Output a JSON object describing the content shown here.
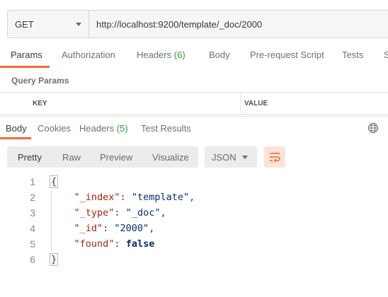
{
  "request": {
    "method": "GET",
    "url": "http://localhost:9200/template/_doc/2000"
  },
  "request_tabs": {
    "params": "Params",
    "authorization": "Authorization",
    "headers": "Headers",
    "headers_count": "(6)",
    "body": "Body",
    "prerequest": "Pre-request Script",
    "tests": "Tests",
    "settings_partial": "S"
  },
  "query_params": {
    "title": "Query Params",
    "key_header": "KEY",
    "value_header": "VALUE"
  },
  "response_tabs": {
    "body": "Body",
    "cookies": "Cookies",
    "headers": "Headers",
    "headers_count": "(5)",
    "test_results": "Test Results"
  },
  "format": {
    "pretty": "Pretty",
    "raw": "Raw",
    "preview": "Preview",
    "visualize": "Visualize",
    "json": "JSON"
  },
  "code": {
    "line_numbers": [
      "1",
      "2",
      "3",
      "4",
      "5",
      "6"
    ],
    "open_brace": "{",
    "close_brace": "}",
    "k_index": "\"_index\"",
    "v_index": "\"template\"",
    "k_type": "\"_type\"",
    "v_type": "\"_doc\"",
    "k_id": "\"_id\"",
    "v_id": "\"2000\"",
    "k_found": "\"found\"",
    "v_found": "false"
  },
  "colors": {
    "accent": "#f26b3a",
    "count_green": "#2a9d3c",
    "json_key": "#a1260d",
    "json_string": "#0c2a7a"
  }
}
